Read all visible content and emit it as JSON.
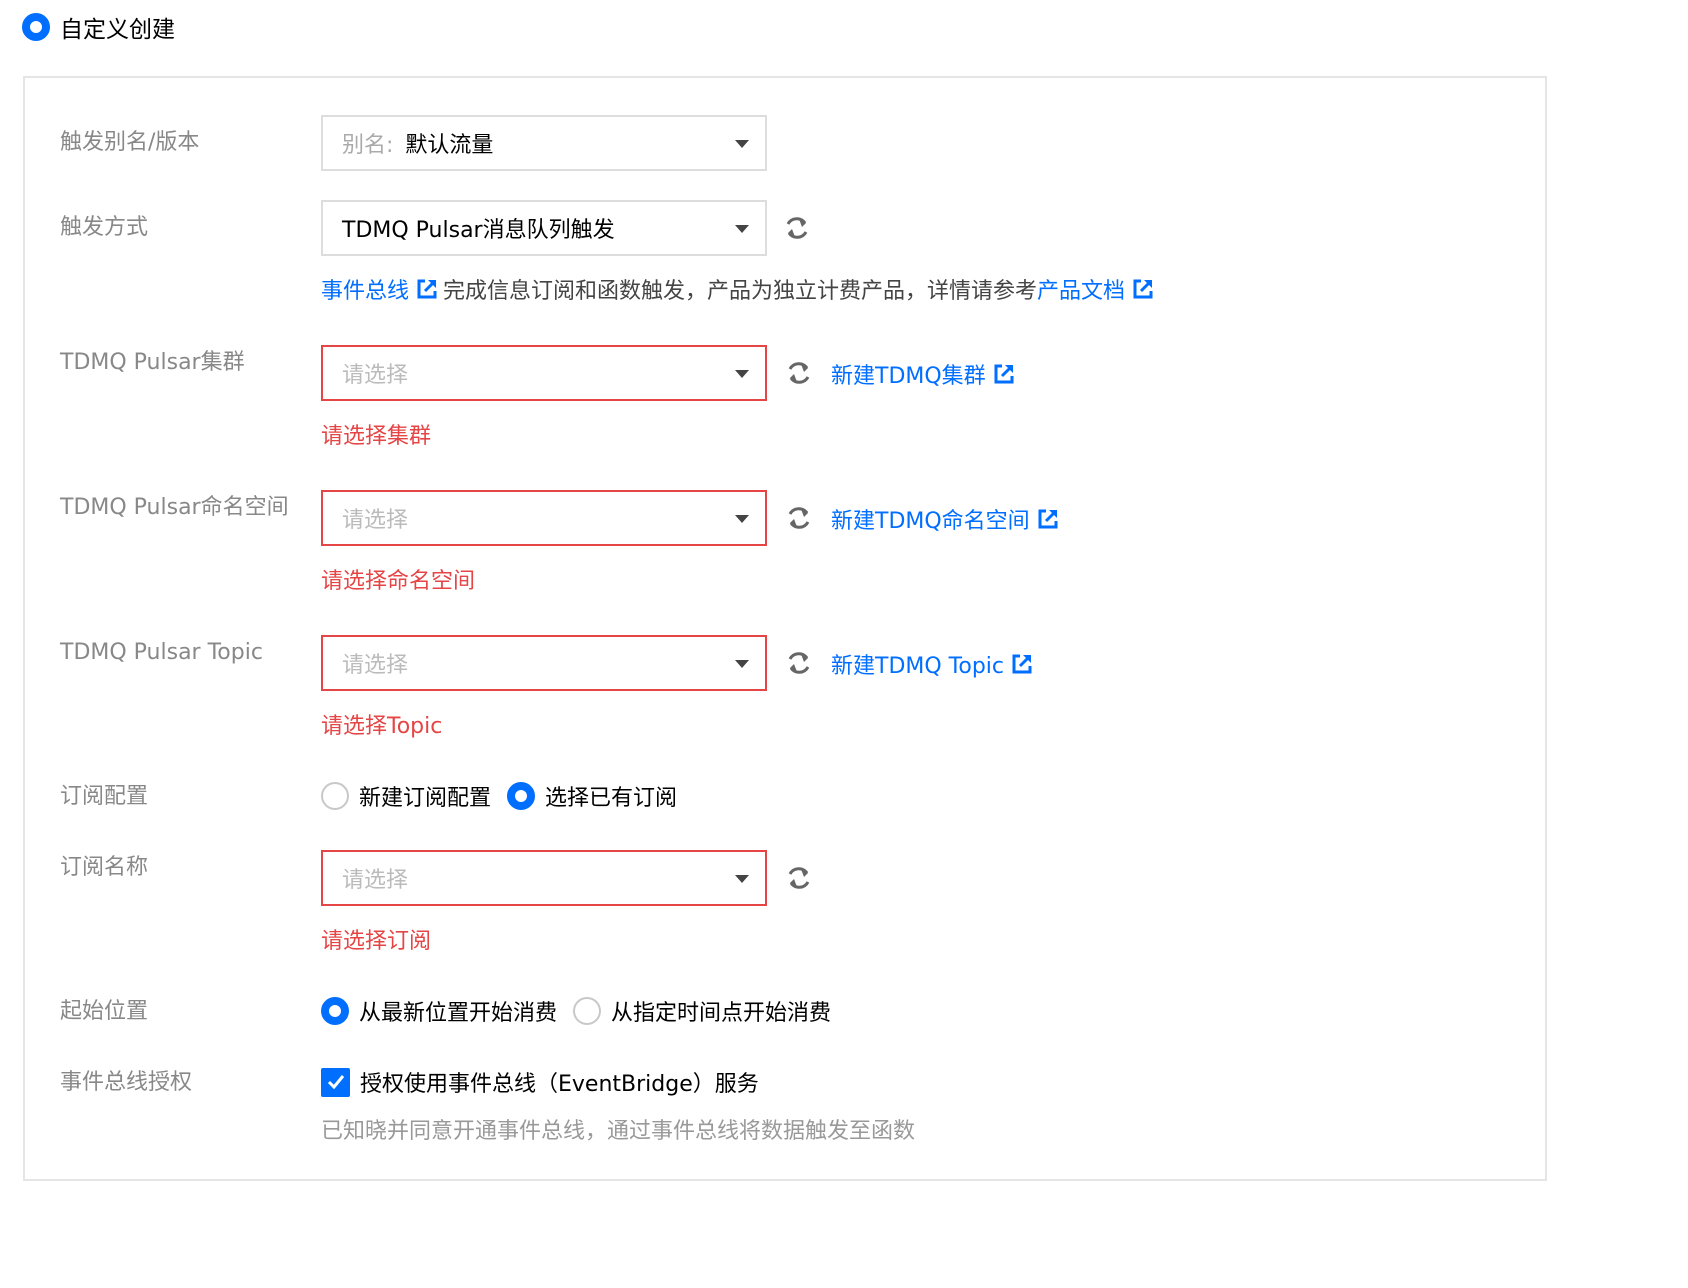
{
  "mode_option": {
    "label": "自定义创建",
    "selected": true
  },
  "form": {
    "alias": {
      "label": "触发别名/版本",
      "prefix": "别名:",
      "value": "默认流量"
    },
    "trigger_method": {
      "label": "触发方式",
      "value": "TDMQ Pulsar消息队列触发",
      "help_link_1": "事件总线",
      "help_text": "完成信息订阅和函数触发，产品为独立计费产品，详情请参考",
      "help_link_2": "产品文档"
    },
    "cluster": {
      "label": "TDMQ Pulsar集群",
      "placeholder": "请选择",
      "link": "新建TDMQ集群",
      "error": "请选择集群"
    },
    "namespace": {
      "label": "TDMQ Pulsar命名空间",
      "placeholder": "请选择",
      "link": "新建TDMQ命名空间",
      "error": "请选择命名空间"
    },
    "topic": {
      "label": "TDMQ Pulsar Topic",
      "placeholder": "请选择",
      "link": "新建TDMQ Topic",
      "error": "请选择Topic"
    },
    "subscription_config": {
      "label": "订阅配置",
      "options": [
        {
          "label": "新建订阅配置",
          "selected": false
        },
        {
          "label": "选择已有订阅",
          "selected": true
        }
      ]
    },
    "subscription_name": {
      "label": "订阅名称",
      "placeholder": "请选择",
      "error": "请选择订阅"
    },
    "start_position": {
      "label": "起始位置",
      "options": [
        {
          "label": "从最新位置开始消费",
          "selected": true
        },
        {
          "label": "从指定时间点开始消费",
          "selected": false
        }
      ]
    },
    "eventbridge_auth": {
      "label": "事件总线授权",
      "checkbox_label": "授权使用事件总线（EventBridge）服务",
      "checked": true,
      "note": "已知晓并同意开通事件总线，通过事件总线将数据触发至函数"
    }
  },
  "colors": {
    "accent": "#006eff",
    "error": "#e54545",
    "label": "#888888",
    "border": "#dddddd"
  },
  "icons": {
    "refresh": "refresh-icon",
    "external_link": "external-link-icon",
    "caret": "caret-down-icon"
  }
}
